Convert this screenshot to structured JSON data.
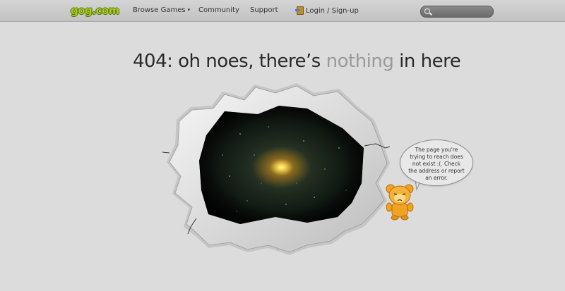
{
  "header": {
    "logo": "gog.com",
    "nav": {
      "browse": "Browse Games",
      "browse_caret": "▾",
      "community": "Community",
      "support": "Support",
      "login": "Login / Sign-up"
    },
    "search": {
      "placeholder": "",
      "value": ""
    }
  },
  "main": {
    "headline_part1": "404: oh noes, there’s ",
    "headline_highlight": "nothing",
    "headline_part2": " in here",
    "bubble_text": "The page you're trying to reach does not exist :(. Check the address or report an error."
  },
  "colors": {
    "background": "#dcdcdc",
    "logo_green": "#a6cd1a",
    "headline": "#2a2a2a",
    "headline_dim": "#9a9a9a",
    "mascot_orange": "#f0a323"
  },
  "icons": {
    "search": "search-icon",
    "login": "login-key-icon",
    "mascot": "sad-mascot-icon"
  }
}
